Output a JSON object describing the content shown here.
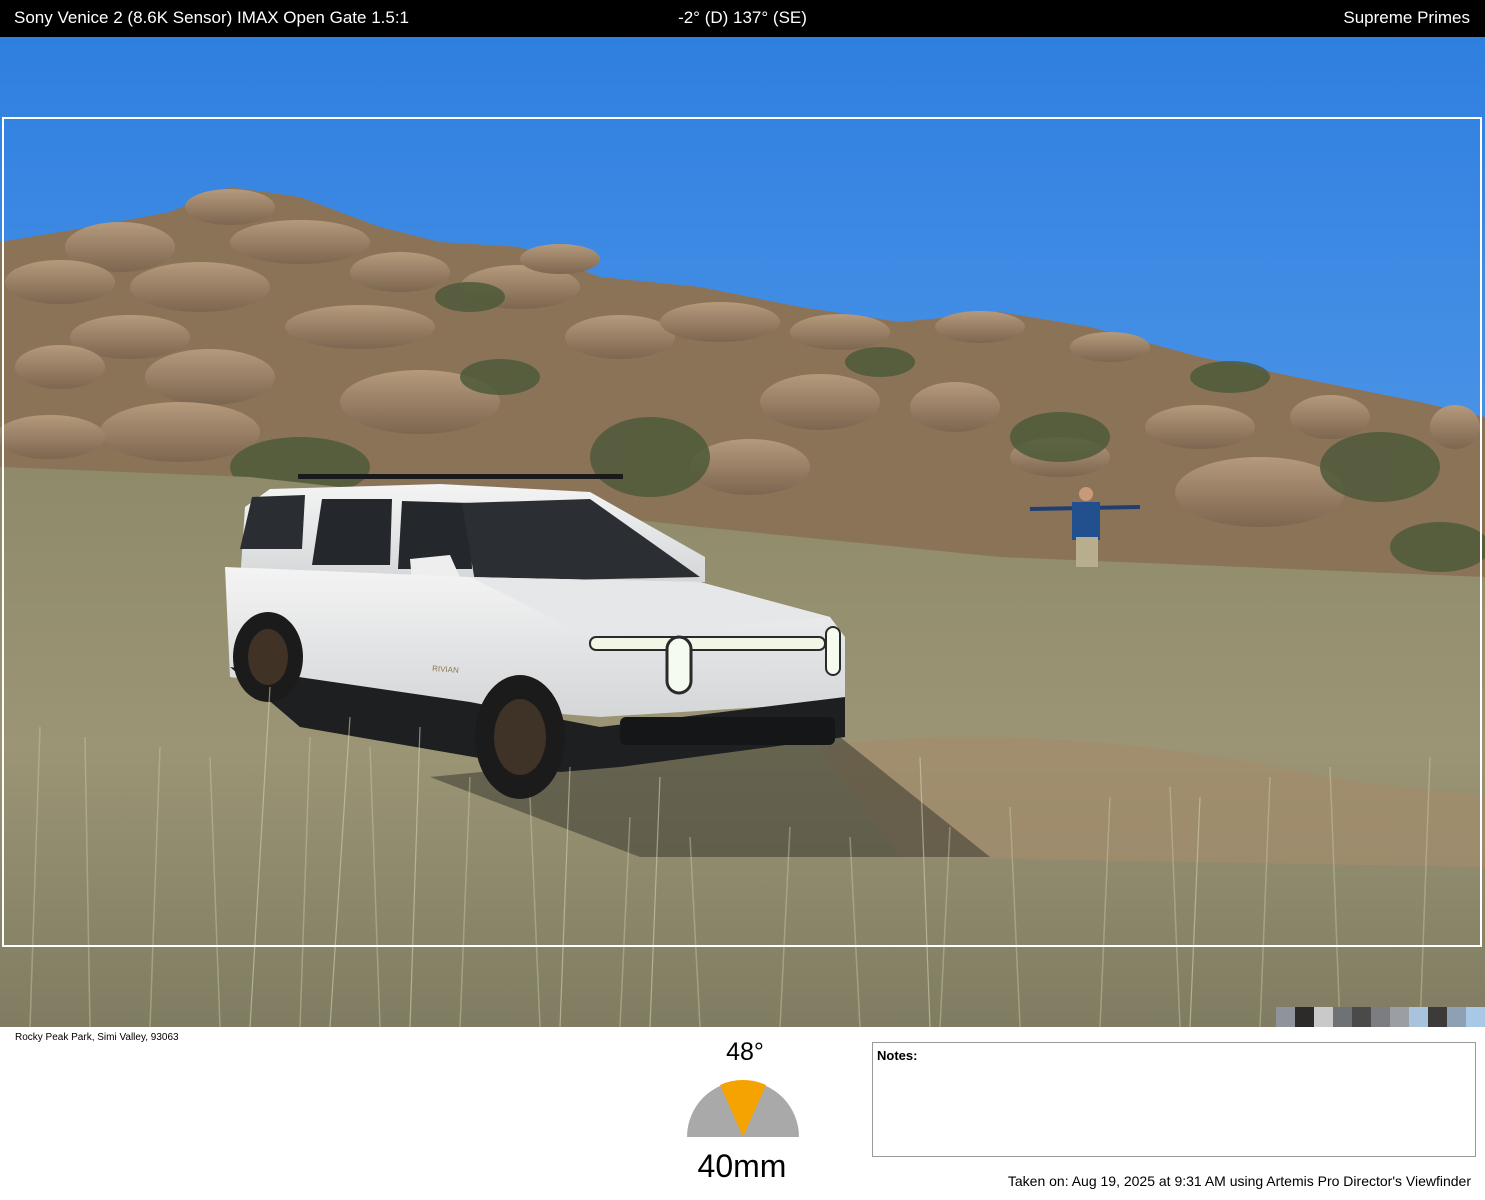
{
  "top_bar": {
    "camera": "Sony Venice 2 (8.6K Sensor) IMAX Open Gate 1.5:1",
    "tilt_heading": "-2° (D) 137° (SE)",
    "lens_set": "Supreme Primes"
  },
  "location": "Rocky Peak Park, Simi Valley, 93063",
  "fov": {
    "angle_label": "48°",
    "focal_length": "40mm",
    "wedge_color": "#f5a300",
    "base_color": "#a9a9a9"
  },
  "notes": {
    "label": "Notes:"
  },
  "footer": {
    "taken_on": "Taken on: Aug 19, 2025 at 9:31 AM using Artemis Pro Director's Viewfinder"
  },
  "photo": {
    "subject_vehicle_badge": "RIVIAN",
    "palette": [
      "#8e949a",
      "#2c2b2a",
      "#c9c9c9",
      "#6f7275",
      "#4a4a4a",
      "#7b7d80",
      "#9b9ea3",
      "#a9c3dc",
      "#3c3b3a",
      "#8ea0b3",
      "#a8c9e6"
    ]
  }
}
